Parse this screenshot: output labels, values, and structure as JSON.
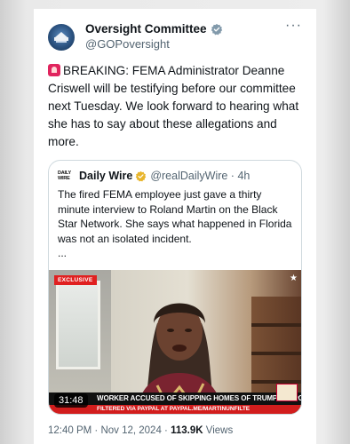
{
  "account": {
    "display_name": "Oversight Committee",
    "handle": "@GOPoversight"
  },
  "tweet": {
    "text": "BREAKING: FEMA Administrator Deanne Criswell will be testifying before our committee next Tuesday. We look forward to hearing what she has to say about these allegations and more."
  },
  "quote": {
    "logo_top": "DAILY",
    "logo_bottom": "WIRE",
    "name": "Daily Wire",
    "handle_time": "@realDailyWire · 4h",
    "text": "The fired FEMA employee just gave a thirty minute interview to Roland Martin on the Black Star Network. She says what happened in Florida was not an isolated incident.",
    "ellipsis": "...",
    "video": {
      "badge": "EXCLUSIVE",
      "duration": "31:48",
      "ticker": "WORKER ACCUSED OF SKIPPING HOMES OF TRUMP SUPPORTERS",
      "subticker": "FILTERED VIA PAYPAL AT PAYPAL.ME/MARTINUNFILTE"
    }
  },
  "meta": {
    "time": "12:40 PM · Nov 12, 2024 · ",
    "views_count": "113.9K",
    "views_label": " Views"
  },
  "icons": {
    "avatar": "house-seal-icon",
    "verified": "gray-verified-badge-icon",
    "gold": "gold-verified-badge-icon",
    "more": "more-dots-icon",
    "siren": "rotating-light-emoji-icon"
  }
}
